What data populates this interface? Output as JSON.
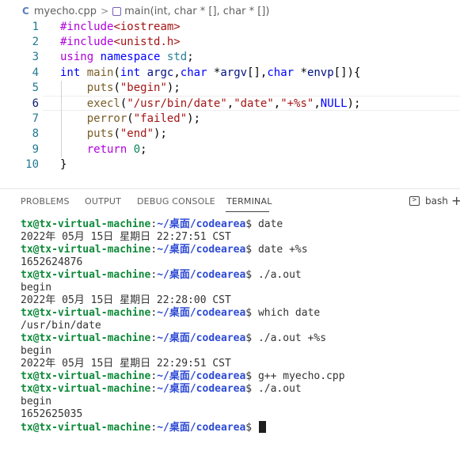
{
  "breadcrumb": {
    "file_icon": "C",
    "file": "myecho.cpp",
    "separator": ">",
    "symbol": "main(int, char * [], char * [])"
  },
  "editor": {
    "active_line": 6,
    "lines": [
      {
        "n": "1",
        "tokens": [
          {
            "t": "#include",
            "c": "pre"
          },
          {
            "t": "<iostream>",
            "c": "str"
          }
        ]
      },
      {
        "n": "2",
        "tokens": [
          {
            "t": "#include",
            "c": "pre"
          },
          {
            "t": "<unistd.h>",
            "c": "str"
          }
        ]
      },
      {
        "n": "3",
        "tokens": [
          {
            "t": "using",
            "c": "pre"
          },
          {
            "t": " ",
            "c": "p"
          },
          {
            "t": "namespace",
            "c": "kw"
          },
          {
            "t": " ",
            "c": "p"
          },
          {
            "t": "std",
            "c": "ns"
          },
          {
            "t": ";",
            "c": "p"
          }
        ]
      },
      {
        "n": "4",
        "tokens": [
          {
            "t": "int",
            "c": "kw"
          },
          {
            "t": " ",
            "c": "p"
          },
          {
            "t": "main",
            "c": "fn"
          },
          {
            "t": "(",
            "c": "p"
          },
          {
            "t": "int",
            "c": "kw"
          },
          {
            "t": " ",
            "c": "p"
          },
          {
            "t": "argc",
            "c": "var"
          },
          {
            "t": ",",
            "c": "p"
          },
          {
            "t": "char",
            "c": "kw"
          },
          {
            "t": " *",
            "c": "p"
          },
          {
            "t": "argv",
            "c": "var"
          },
          {
            "t": "[],",
            "c": "p"
          },
          {
            "t": "char",
            "c": "kw"
          },
          {
            "t": " *",
            "c": "p"
          },
          {
            "t": "envp",
            "c": "var"
          },
          {
            "t": "[]){",
            "c": "p"
          }
        ]
      },
      {
        "n": "5",
        "tokens": [
          {
            "t": "    ",
            "c": "p"
          },
          {
            "t": "puts",
            "c": "fn"
          },
          {
            "t": "(",
            "c": "p"
          },
          {
            "t": "\"begin\"",
            "c": "str"
          },
          {
            "t": ");",
            "c": "p"
          }
        ]
      },
      {
        "n": "6",
        "tokens": [
          {
            "t": "    ",
            "c": "p"
          },
          {
            "t": "execl",
            "c": "fn"
          },
          {
            "t": "(",
            "c": "p"
          },
          {
            "t": "\"/usr/bin/date\"",
            "c": "str"
          },
          {
            "t": ",",
            "c": "p"
          },
          {
            "t": "\"date\"",
            "c": "str"
          },
          {
            "t": ",",
            "c": "p"
          },
          {
            "t": "\"+%s\"",
            "c": "str"
          },
          {
            "t": ",",
            "c": "p"
          },
          {
            "t": "NULL",
            "c": "const"
          },
          {
            "t": ");",
            "c": "p"
          }
        ]
      },
      {
        "n": "7",
        "tokens": [
          {
            "t": "    ",
            "c": "p"
          },
          {
            "t": "perror",
            "c": "fn"
          },
          {
            "t": "(",
            "c": "p"
          },
          {
            "t": "\"failed\"",
            "c": "str"
          },
          {
            "t": ");",
            "c": "p"
          }
        ]
      },
      {
        "n": "8",
        "tokens": [
          {
            "t": "    ",
            "c": "p"
          },
          {
            "t": "puts",
            "c": "fn"
          },
          {
            "t": "(",
            "c": "p"
          },
          {
            "t": "\"end\"",
            "c": "str"
          },
          {
            "t": ");",
            "c": "p"
          }
        ]
      },
      {
        "n": "9",
        "tokens": [
          {
            "t": "    ",
            "c": "p"
          },
          {
            "t": "return",
            "c": "pre"
          },
          {
            "t": " ",
            "c": "p"
          },
          {
            "t": "0",
            "c": "num"
          },
          {
            "t": ";",
            "c": "p"
          }
        ]
      },
      {
        "n": "10",
        "tokens": [
          {
            "t": "}",
            "c": "p"
          }
        ]
      }
    ]
  },
  "panel": {
    "tabs": [
      "PROBLEMS",
      "OUTPUT",
      "DEBUG CONSOLE",
      "TERMINAL"
    ],
    "active_tab": "TERMINAL",
    "shell_icon": "terminal-bash-icon",
    "shell_label": "bash",
    "add_icon": "+"
  },
  "terminal": {
    "prompt_user": "tx@tx-virtual-machine",
    "prompt_path": "~/桌面/codearea",
    "lines": [
      {
        "type": "prompt",
        "cmd": " date"
      },
      {
        "type": "out",
        "text": "2022年 05月 15日 星期日 22:27:51 CST"
      },
      {
        "type": "prompt",
        "cmd": " date +%s"
      },
      {
        "type": "out",
        "text": "1652624876"
      },
      {
        "type": "prompt",
        "cmd": " ./a.out"
      },
      {
        "type": "out",
        "text": "begin"
      },
      {
        "type": "out",
        "text": "2022年 05月 15日 星期日 22:28:00 CST"
      },
      {
        "type": "prompt",
        "cmd": " which date"
      },
      {
        "type": "out",
        "text": "/usr/bin/date"
      },
      {
        "type": "prompt",
        "cmd": " ./a.out +%s"
      },
      {
        "type": "out",
        "text": "begin"
      },
      {
        "type": "out",
        "text": "2022年 05月 15日 星期日 22:29:51 CST"
      },
      {
        "type": "prompt",
        "cmd": " g++ myecho.cpp"
      },
      {
        "type": "prompt",
        "cmd": " ./a.out"
      },
      {
        "type": "out",
        "text": "begin"
      },
      {
        "type": "out",
        "text": "1652625035"
      },
      {
        "type": "prompt",
        "cmd": " ",
        "cursor": true
      }
    ]
  }
}
